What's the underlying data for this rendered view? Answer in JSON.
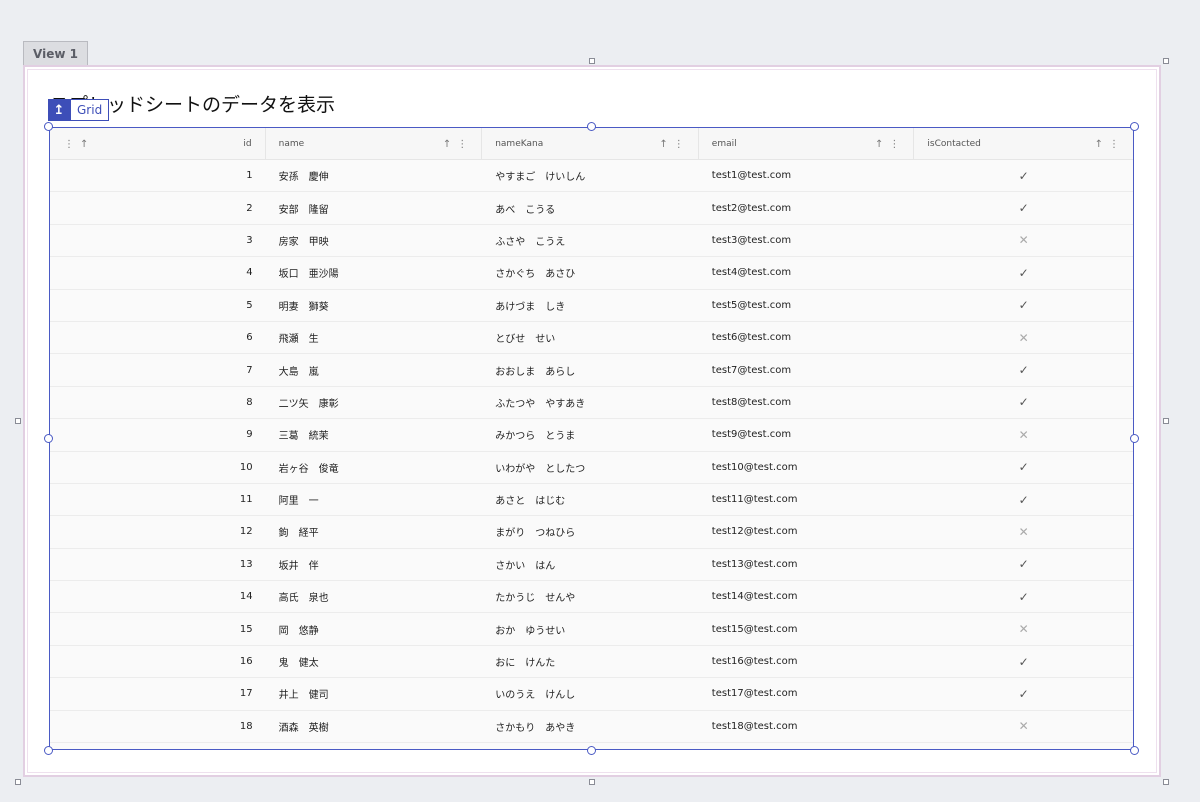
{
  "view": {
    "tab_label": "View 1"
  },
  "page": {
    "title": "スプレッドシートのデータを表示"
  },
  "grid": {
    "badge_label": "Grid",
    "columns": [
      {
        "key": "id",
        "label": "id"
      },
      {
        "key": "name",
        "label": "name"
      },
      {
        "key": "nameKana",
        "label": "nameKana"
      },
      {
        "key": "email",
        "label": "email"
      },
      {
        "key": "isContacted",
        "label": "isContacted"
      }
    ],
    "rows": [
      {
        "id": "1",
        "name": "安孫　慶伸",
        "nameKana": "やすまご　けいしん",
        "email": "test1@test.com",
        "isContacted": true
      },
      {
        "id": "2",
        "name": "安部　隆留",
        "nameKana": "あべ　こうる",
        "email": "test2@test.com",
        "isContacted": true
      },
      {
        "id": "3",
        "name": "房家　甲映",
        "nameKana": "ふさや　こうえ",
        "email": "test3@test.com",
        "isContacted": false
      },
      {
        "id": "4",
        "name": "坂口　亜沙陽",
        "nameKana": "さかぐち　あさひ",
        "email": "test4@test.com",
        "isContacted": true
      },
      {
        "id": "5",
        "name": "明妻　獅葵",
        "nameKana": "あけづま　しき",
        "email": "test5@test.com",
        "isContacted": true
      },
      {
        "id": "6",
        "name": "飛瀬　生",
        "nameKana": "とびせ　せい",
        "email": "test6@test.com",
        "isContacted": false
      },
      {
        "id": "7",
        "name": "大島　嵐",
        "nameKana": "おおしま　あらし",
        "email": "test7@test.com",
        "isContacted": true
      },
      {
        "id": "8",
        "name": "二ツ矢　康彰",
        "nameKana": "ふたつや　やすあき",
        "email": "test8@test.com",
        "isContacted": true
      },
      {
        "id": "9",
        "name": "三葛　統茉",
        "nameKana": "みかつら　とうま",
        "email": "test9@test.com",
        "isContacted": false
      },
      {
        "id": "10",
        "name": "岩ヶ谷　俊竜",
        "nameKana": "いわがや　としたつ",
        "email": "test10@test.com",
        "isContacted": true
      },
      {
        "id": "11",
        "name": "阿里　一",
        "nameKana": "あさと　はじむ",
        "email": "test11@test.com",
        "isContacted": true
      },
      {
        "id": "12",
        "name": "鉤　経平",
        "nameKana": "まがり　つねひら",
        "email": "test12@test.com",
        "isContacted": false
      },
      {
        "id": "13",
        "name": "坂井　伴",
        "nameKana": "さかい　はん",
        "email": "test13@test.com",
        "isContacted": true
      },
      {
        "id": "14",
        "name": "高氏　泉也",
        "nameKana": "たかうじ　せんや",
        "email": "test14@test.com",
        "isContacted": true
      },
      {
        "id": "15",
        "name": "岡　悠静",
        "nameKana": "おか　ゆうせい",
        "email": "test15@test.com",
        "isContacted": false
      },
      {
        "id": "16",
        "name": "鬼　健太",
        "nameKana": "おに　けんた",
        "email": "test16@test.com",
        "isContacted": true
      },
      {
        "id": "17",
        "name": "井上　健司",
        "nameKana": "いのうえ　けんし",
        "email": "test17@test.com",
        "isContacted": true
      },
      {
        "id": "18",
        "name": "酒森　英樹",
        "nameKana": "さかもり　あやき",
        "email": "test18@test.com",
        "isContacted": false
      }
    ],
    "symbols": {
      "true": "✓",
      "false": "✕"
    }
  },
  "icons": {
    "sort": "sort-ascending-icon",
    "menu": "column-menu-icon",
    "select_up": "select-parent-icon"
  },
  "colors": {
    "selection": "#4a5ac4",
    "badge": "#3d4eb8",
    "view_border": "#e2cfe2"
  }
}
